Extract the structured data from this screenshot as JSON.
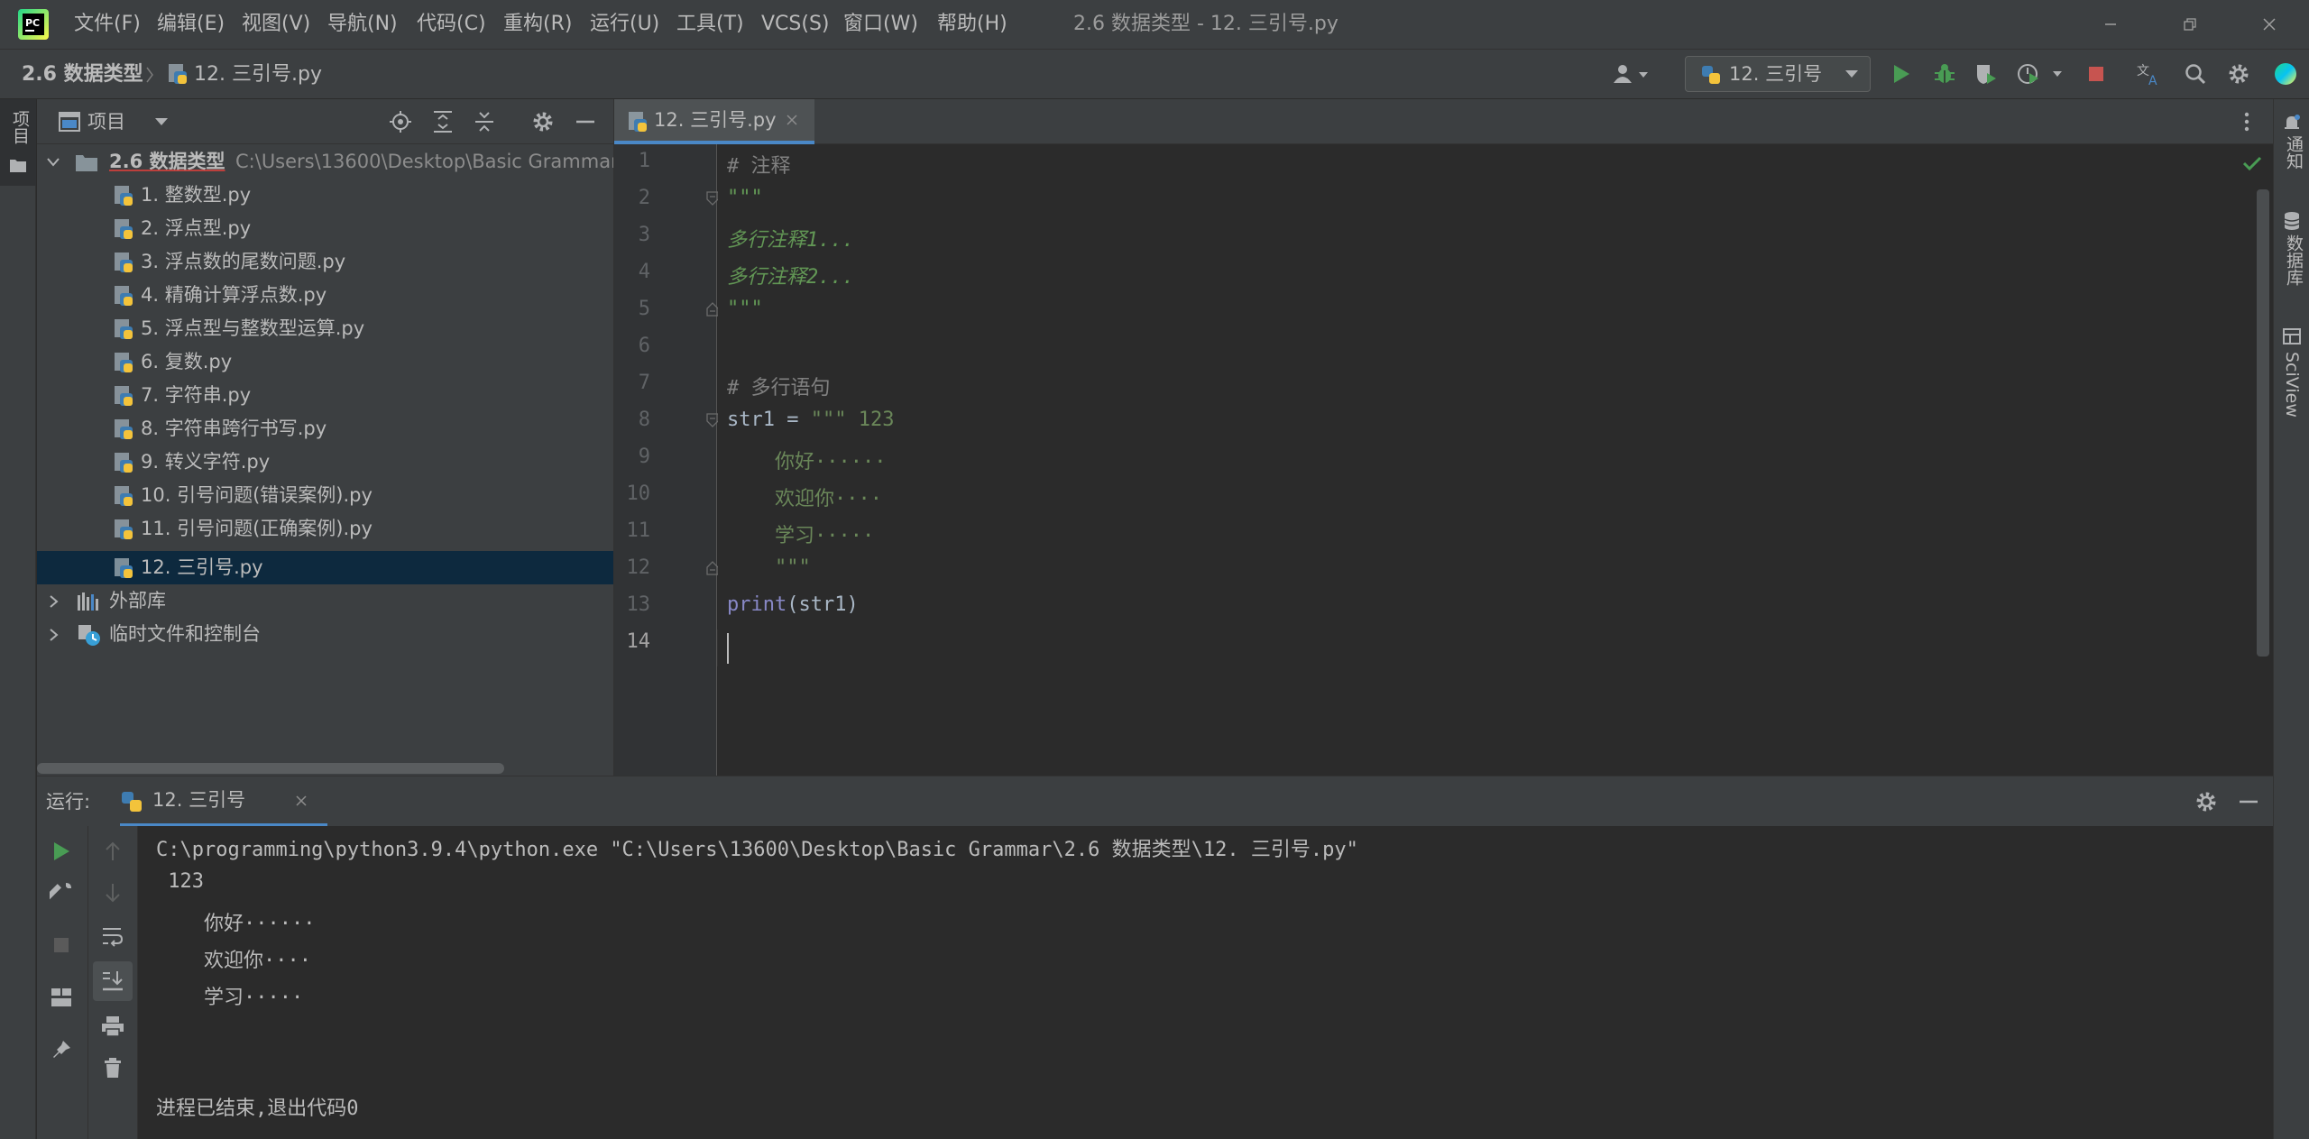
{
  "menu": {
    "items": [
      "文件(F)",
      "编辑(E)",
      "视图(V)",
      "导航(N)",
      "代码(C)",
      "重构(R)",
      "运行(U)",
      "工具(T)",
      "VCS(S)",
      "窗口(W)",
      "帮助(H)"
    ],
    "window_title": "2.6 数据类型 - 12. 三引号.py"
  },
  "nav": {
    "project": "2.6 数据类型",
    "file": "12. 三引号.py",
    "run_config": "12. 三引号"
  },
  "left_strip": {
    "project_label": "项目"
  },
  "right_strip": {
    "notifications": "通知",
    "database": "数据库",
    "sciview": "SciView"
  },
  "project": {
    "header_label": "项目",
    "root": {
      "name": "2.6 数据类型",
      "path": "C:\\Users\\13600\\Desktop\\Basic Grammar"
    },
    "files": [
      "1. 整数型.py",
      "2. 浮点型.py",
      "3. 浮点数的尾数问题.py",
      "4. 精确计算浮点数.py",
      "5. 浮点型与整数型运算.py",
      "6. 复数.py",
      "7. 字符串.py",
      "8. 字符串跨行书写.py",
      "9. 转义字符.py",
      "10. 引号问题(错误案例).py",
      "11. 引号问题(正确案例).py",
      "12. 三引号.py"
    ],
    "external_libs": "外部库",
    "scratches": "临时文件和控制台"
  },
  "editor": {
    "tab": "12. 三引号.py",
    "line_numbers": [
      "1",
      "2",
      "3",
      "4",
      "5",
      "6",
      "7",
      "8",
      "9",
      "10",
      "11",
      "12",
      "13",
      "14"
    ],
    "lines": {
      "l1": "# 注释",
      "l2": "\"\"\"",
      "l3": "多行注释1...",
      "l4": "多行注释2...",
      "l5": "\"\"\"",
      "l7": "# 多行语句",
      "l8_a": "str1 = ",
      "l8_b": "\"\"\" 123",
      "l9": "    你好······",
      "l10": "    欢迎你····",
      "l11": "    学习·····",
      "l12": "    \"\"\"",
      "l13_a": "print",
      "l13_b": "(str1)"
    }
  },
  "run": {
    "label": "运行:",
    "tab": "12. 三引号",
    "console": [
      "C:\\programming\\python3.9.4\\python.exe \"C:\\Users\\13600\\Desktop\\Basic Grammar\\2.6 数据类型\\12. 三引号.py\"",
      " 123",
      "    你好······",
      "    欢迎你····",
      "    学习·····",
      "",
      "",
      "进程已结束,退出代码0"
    ]
  },
  "colors": {
    "accent": "#4a88c7",
    "run_green": "#499c54",
    "stop_red": "#c75450",
    "selection": "#0d293e"
  }
}
